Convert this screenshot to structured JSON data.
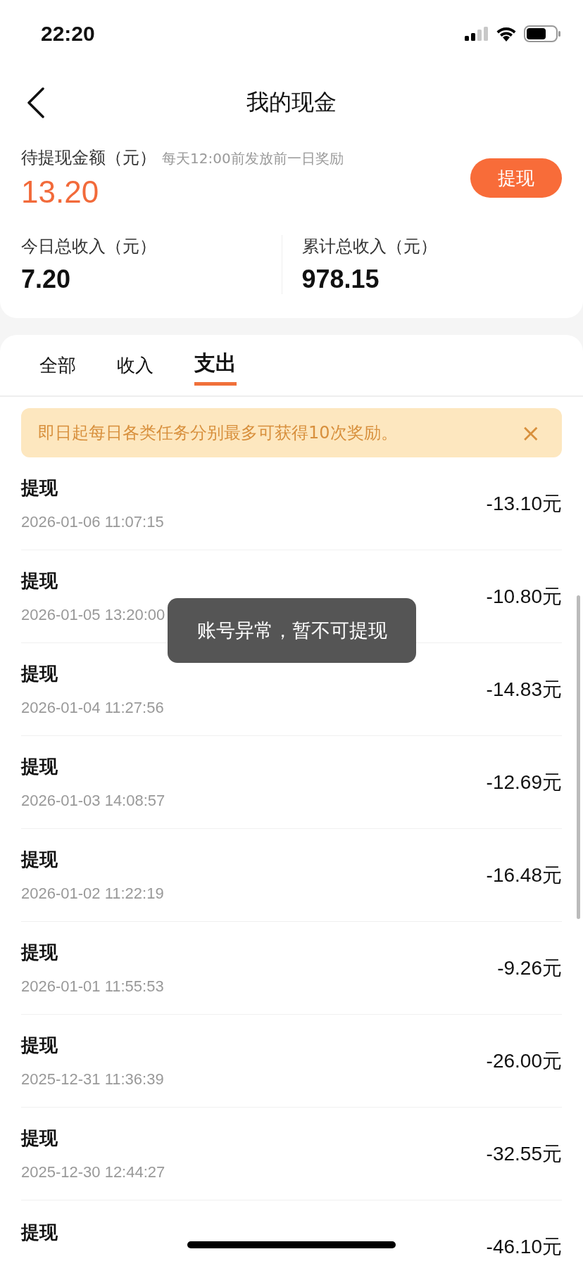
{
  "status_bar": {
    "time": "22:20"
  },
  "nav": {
    "title": "我的现金"
  },
  "summary": {
    "pending_label": "待提现金额（元）",
    "pending_hint": "每天12:00前发放前一日奖励",
    "pending_amount": "13.20",
    "withdraw_button": "提现",
    "stats": [
      {
        "label": "今日总收入（元）",
        "value": "7.20"
      },
      {
        "label": "累计总收入（元）",
        "value": "978.15"
      }
    ]
  },
  "tabs": [
    {
      "label": "全部",
      "selected": false
    },
    {
      "label": "收入",
      "selected": false
    },
    {
      "label": "支出",
      "selected": true
    }
  ],
  "notice": {
    "text": "即日起每日各类任务分别最多可获得10次奖励。",
    "close": "×"
  },
  "records": [
    {
      "title": "提现",
      "date": "2026-01-06 11:07:15",
      "amount": "-13.10元"
    },
    {
      "title": "提现",
      "date": "2026-01-05 13:20:00",
      "amount": "-10.80元"
    },
    {
      "title": "提现",
      "date": "2026-01-04 11:27:56",
      "amount": "-14.83元"
    },
    {
      "title": "提现",
      "date": "2026-01-03 14:08:57",
      "amount": "-12.69元"
    },
    {
      "title": "提现",
      "date": "2026-01-02 11:22:19",
      "amount": "-16.48元"
    },
    {
      "title": "提现",
      "date": "2026-01-01 11:55:53",
      "amount": "-9.26元"
    },
    {
      "title": "提现",
      "date": "2025-12-31 11:36:39",
      "amount": "-26.00元"
    },
    {
      "title": "提现",
      "date": "2025-12-30 12:44:27",
      "amount": "-32.55元"
    },
    {
      "title": "提现",
      "amount": "-46.10元"
    }
  ],
  "toast": {
    "text": "账号异常，暂不可提现"
  }
}
